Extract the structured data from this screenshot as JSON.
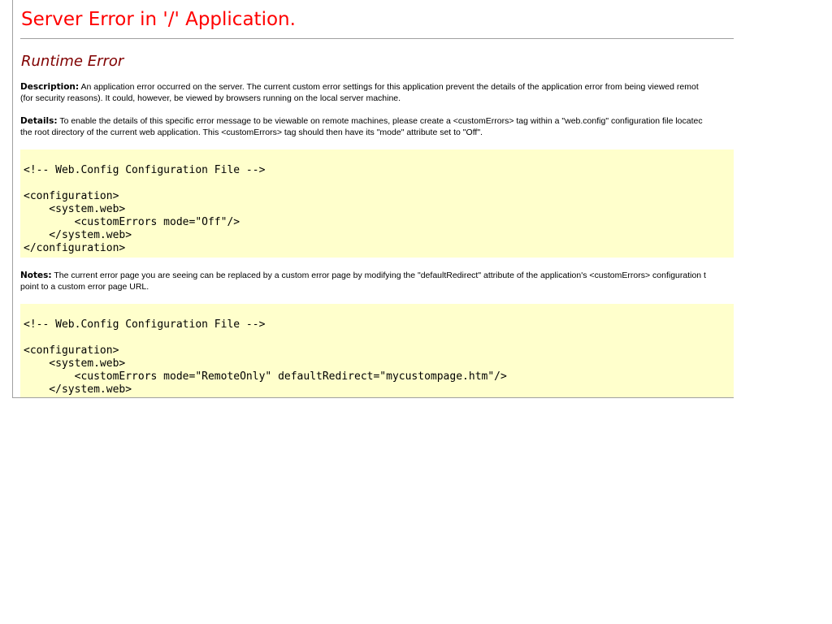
{
  "page": {
    "title": "Server Error in '/' Application.",
    "subtitle": "Runtime Error"
  },
  "description": {
    "label": "Description:",
    "line1": "An application error occurred on the server. The current custom error settings for this application prevent the details of the application error from being viewed remot",
    "line2": "(for security reasons). It could, however, be viewed by browsers running on the local server machine."
  },
  "details": {
    "label": "Details:",
    "line1": "To enable the details of this specific error message to be viewable on remote machines, please create a <customErrors> tag within a \"web.config\" configuration file locatec",
    "line2": "the root directory of the current web application. This <customErrors> tag should then have its \"mode\" attribute set to \"Off\"."
  },
  "code1": {
    "text": "<!-- Web.Config Configuration File -->\n\n<configuration>\n    <system.web>\n        <customErrors mode=\"Off\"/>\n    </system.web>\n</configuration>"
  },
  "notes": {
    "label": "Notes:",
    "line1": "The current error page you are seeing can be replaced by a custom error page by modifying the \"defaultRedirect\" attribute of the application's <customErrors> configuration t",
    "line2": "point to a custom error page URL."
  },
  "code2": {
    "text": "<!-- Web.Config Configuration File -->\n\n<configuration>\n    <system.web>\n        <customErrors mode=\"RemoteOnly\" defaultRedirect=\"mycustompage.htm\"/>\n    </system.web>"
  }
}
